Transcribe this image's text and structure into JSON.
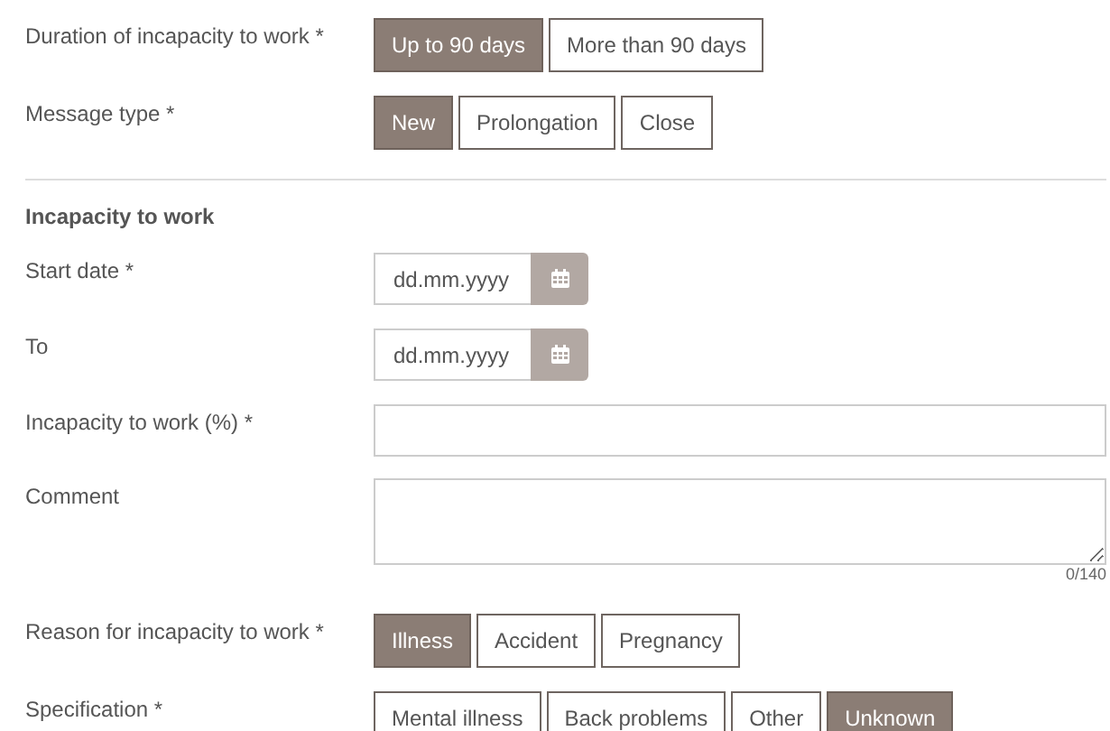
{
  "fields": [
    {
      "kind": "toggle",
      "label": "Duration of incapacity to work *",
      "options": [
        {
          "label": "Up to 90 days",
          "selected": true
        },
        {
          "label": "More than 90 days",
          "selected": false
        }
      ]
    },
    {
      "kind": "toggle",
      "label": "Message type *",
      "options": [
        {
          "label": "New",
          "selected": true
        },
        {
          "label": "Prolongation",
          "selected": false
        },
        {
          "label": "Close",
          "selected": false
        }
      ]
    },
    {
      "kind": "divider"
    },
    {
      "kind": "heading",
      "label": "Incapacity to work"
    },
    {
      "kind": "date",
      "label": "Start date *",
      "placeholder": "dd.mm.yyyy"
    },
    {
      "kind": "date",
      "label": "To",
      "placeholder": "dd.mm.yyyy"
    },
    {
      "kind": "text",
      "label": "Incapacity to work (%) *"
    },
    {
      "kind": "textarea",
      "label": "Comment",
      "counter": "0/140"
    },
    {
      "kind": "toggle",
      "label": "Reason for incapacity to work *",
      "options": [
        {
          "label": "Illness",
          "selected": true
        },
        {
          "label": "Accident",
          "selected": false
        },
        {
          "label": "Pregnancy",
          "selected": false
        }
      ]
    },
    {
      "kind": "toggle",
      "label": "Specification *",
      "options": [
        {
          "label": "Mental illness",
          "selected": false
        },
        {
          "label": "Back problems",
          "selected": false
        },
        {
          "label": "Other",
          "selected": false
        },
        {
          "label": "Unknown",
          "selected": true
        }
      ]
    }
  ]
}
